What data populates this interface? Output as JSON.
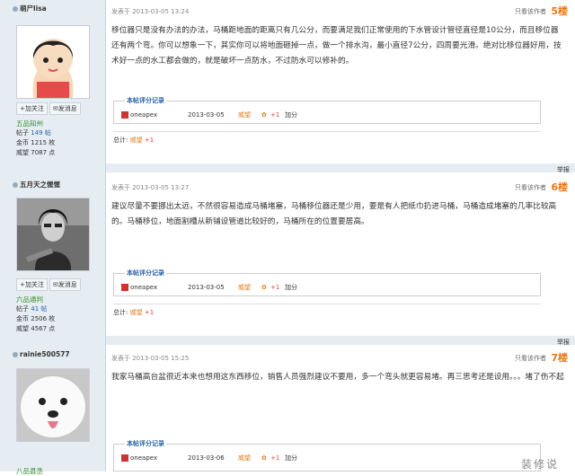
{
  "posts": [
    {
      "username": "萌尸lisa",
      "rank": "五品知州",
      "stats_labels": [
        "帖子",
        "金币",
        "威望"
      ],
      "stats": [
        "149 帖",
        "1215 枚",
        "7087 点"
      ],
      "follow": "加关注",
      "message": "发消息",
      "posted": "发表于 2013-03-05 13:24",
      "only_author": "只看该作者",
      "floor": "5楼",
      "content": "移位器只是没有办法的办法，马桶距地面的距离只有几公分，而要满足我们正常使用的下水管设计管径直径是10公分，而且移位器还有两个弯。你可以想象一下，其实你可以将地面砸掉一点，做一个排水沟，最小直径7公分，四周要光滑。绝对比移位器好用，技术好一点的水工都会做的，就是破坏一点防水，不过防水可以修补的。",
      "rate_title": "本帖评分记录",
      "rate_user": "oneapex",
      "rate_date": "2013-03-05",
      "rate_type": "威望",
      "rate_value": "+1",
      "rate_reason": "加分",
      "total_label": "总计:",
      "total_type": "威望",
      "total_value": "+1",
      "report": "举报"
    },
    {
      "username": "五月天之惺惺",
      "rank": "六品通判",
      "stats_labels": [
        "帖子",
        "金币",
        "威望"
      ],
      "stats": [
        "41 帖",
        "2506 枚",
        "4567 点"
      ],
      "follow": "加关注",
      "message": "发消息",
      "posted": "发表于 2013-03-05 13:27",
      "only_author": "只看该作者",
      "floor": "6楼",
      "content": "建议尽量不要挪出太远，不然很容易造成马桶堵塞，马桶移位器还是少用，要是有人把纸巾扔进马桶，马桶造成堵塞的几率比较高的。马桶移位，地面割槽从新铺设管道比较好的，马桶所在的位置要居高。",
      "rate_title": "本帖评分记录",
      "rate_user": "oneapex",
      "rate_date": "2013-03-05",
      "rate_type": "威望",
      "rate_value": "+1",
      "rate_reason": "加分",
      "total_label": "总计:",
      "total_type": "威望",
      "total_value": "+1",
      "report": "举报"
    },
    {
      "username": "rainie500577",
      "rank": "八品县丞",
      "posted": "发表于 2013-03-05 15:25",
      "only_author": "只看该作者",
      "floor": "7楼",
      "content": "我家马桶高台盆很近本来也想用这东西移位，销售人员强烈建议不要用，多一个弯头就更容易堵。再三思考还是设用。。。堵了伤不起",
      "rate_title": "本帖评分记录",
      "rate_user": "oneapex",
      "rate_date": "2013-03-06",
      "rate_type": "威望",
      "rate_value": "+1",
      "rate_reason": "加分"
    }
  ],
  "watermark": "装修说"
}
